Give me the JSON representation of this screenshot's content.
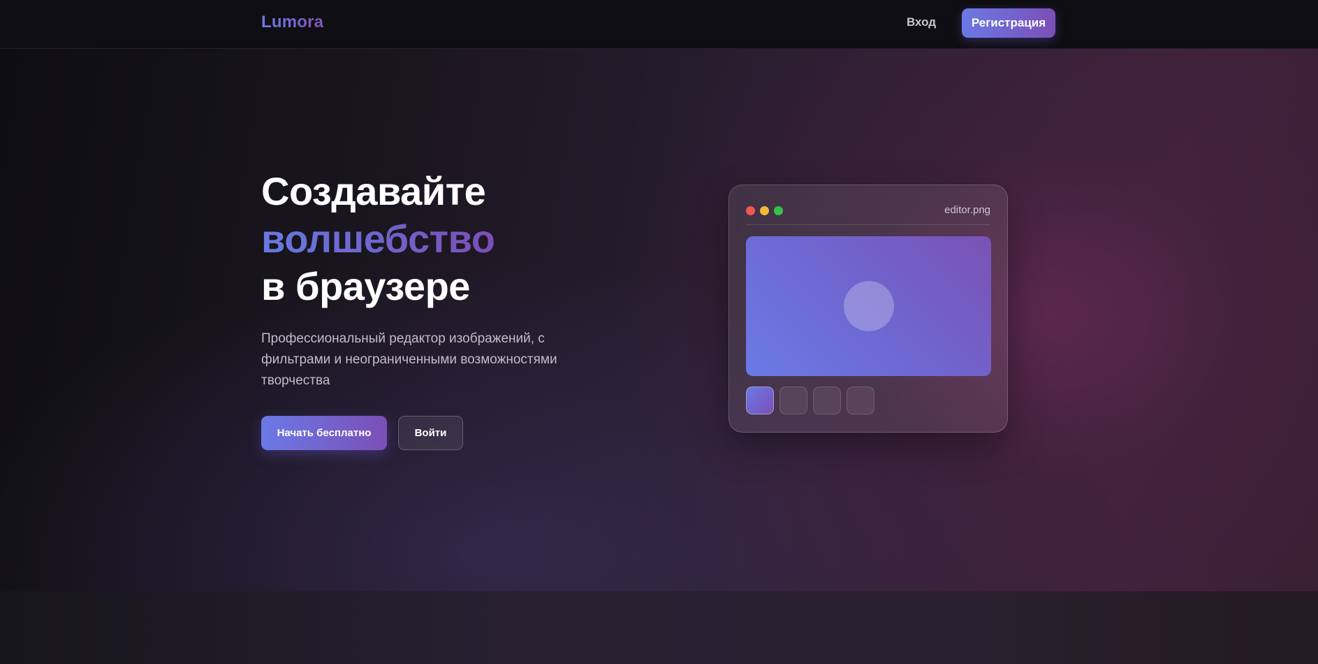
{
  "header": {
    "logo": "Lumora",
    "login_label": "Вход",
    "register_label": "Регистрация"
  },
  "hero": {
    "title_line1": "Создавайте",
    "title_line2": "волшебство",
    "title_line3": "в браузере",
    "description": "Профессиональный редактор изображений, с фильтрами и неограниченными возможностями творчества",
    "primary_button": "Начать бесплатно",
    "secondary_button": "Войти"
  },
  "editor": {
    "filename": "editor.png",
    "window_dots": [
      "red",
      "yellow",
      "green"
    ],
    "thumbnails": [
      {
        "active": true
      },
      {
        "active": false
      },
      {
        "active": false
      },
      {
        "active": false
      }
    ]
  },
  "colors": {
    "accent_start": "#6b79e6",
    "accent_end": "#7b4fb6",
    "background": "#0d0d11"
  }
}
